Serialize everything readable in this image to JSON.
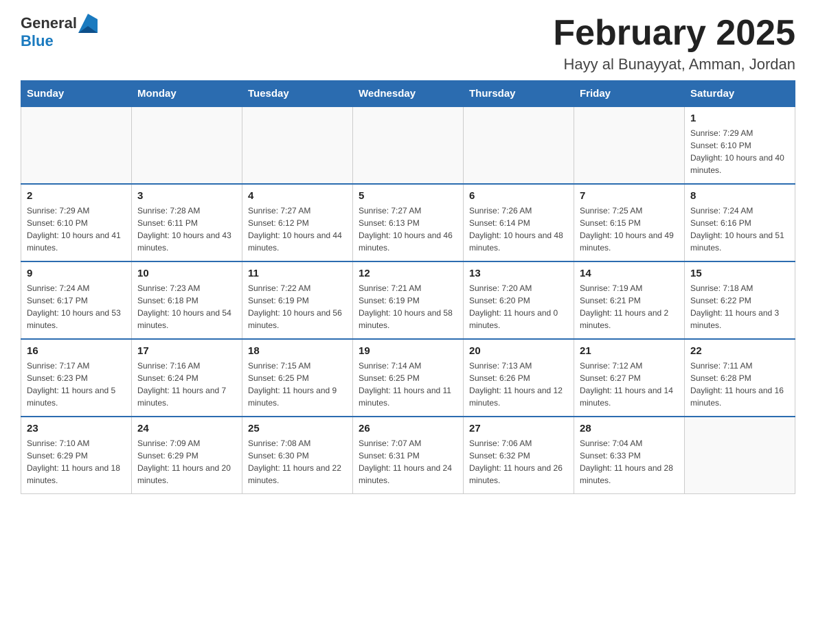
{
  "header": {
    "logo_general": "General",
    "logo_blue": "Blue",
    "month_title": "February 2025",
    "location": "Hayy al Bunayyat, Amman, Jordan"
  },
  "days_of_week": [
    "Sunday",
    "Monday",
    "Tuesday",
    "Wednesday",
    "Thursday",
    "Friday",
    "Saturday"
  ],
  "weeks": [
    [
      {
        "day": "",
        "info": ""
      },
      {
        "day": "",
        "info": ""
      },
      {
        "day": "",
        "info": ""
      },
      {
        "day": "",
        "info": ""
      },
      {
        "day": "",
        "info": ""
      },
      {
        "day": "",
        "info": ""
      },
      {
        "day": "1",
        "info": "Sunrise: 7:29 AM\nSunset: 6:10 PM\nDaylight: 10 hours and 40 minutes."
      }
    ],
    [
      {
        "day": "2",
        "info": "Sunrise: 7:29 AM\nSunset: 6:10 PM\nDaylight: 10 hours and 41 minutes."
      },
      {
        "day": "3",
        "info": "Sunrise: 7:28 AM\nSunset: 6:11 PM\nDaylight: 10 hours and 43 minutes."
      },
      {
        "day": "4",
        "info": "Sunrise: 7:27 AM\nSunset: 6:12 PM\nDaylight: 10 hours and 44 minutes."
      },
      {
        "day": "5",
        "info": "Sunrise: 7:27 AM\nSunset: 6:13 PM\nDaylight: 10 hours and 46 minutes."
      },
      {
        "day": "6",
        "info": "Sunrise: 7:26 AM\nSunset: 6:14 PM\nDaylight: 10 hours and 48 minutes."
      },
      {
        "day": "7",
        "info": "Sunrise: 7:25 AM\nSunset: 6:15 PM\nDaylight: 10 hours and 49 minutes."
      },
      {
        "day": "8",
        "info": "Sunrise: 7:24 AM\nSunset: 6:16 PM\nDaylight: 10 hours and 51 minutes."
      }
    ],
    [
      {
        "day": "9",
        "info": "Sunrise: 7:24 AM\nSunset: 6:17 PM\nDaylight: 10 hours and 53 minutes."
      },
      {
        "day": "10",
        "info": "Sunrise: 7:23 AM\nSunset: 6:18 PM\nDaylight: 10 hours and 54 minutes."
      },
      {
        "day": "11",
        "info": "Sunrise: 7:22 AM\nSunset: 6:19 PM\nDaylight: 10 hours and 56 minutes."
      },
      {
        "day": "12",
        "info": "Sunrise: 7:21 AM\nSunset: 6:19 PM\nDaylight: 10 hours and 58 minutes."
      },
      {
        "day": "13",
        "info": "Sunrise: 7:20 AM\nSunset: 6:20 PM\nDaylight: 11 hours and 0 minutes."
      },
      {
        "day": "14",
        "info": "Sunrise: 7:19 AM\nSunset: 6:21 PM\nDaylight: 11 hours and 2 minutes."
      },
      {
        "day": "15",
        "info": "Sunrise: 7:18 AM\nSunset: 6:22 PM\nDaylight: 11 hours and 3 minutes."
      }
    ],
    [
      {
        "day": "16",
        "info": "Sunrise: 7:17 AM\nSunset: 6:23 PM\nDaylight: 11 hours and 5 minutes."
      },
      {
        "day": "17",
        "info": "Sunrise: 7:16 AM\nSunset: 6:24 PM\nDaylight: 11 hours and 7 minutes."
      },
      {
        "day": "18",
        "info": "Sunrise: 7:15 AM\nSunset: 6:25 PM\nDaylight: 11 hours and 9 minutes."
      },
      {
        "day": "19",
        "info": "Sunrise: 7:14 AM\nSunset: 6:25 PM\nDaylight: 11 hours and 11 minutes."
      },
      {
        "day": "20",
        "info": "Sunrise: 7:13 AM\nSunset: 6:26 PM\nDaylight: 11 hours and 12 minutes."
      },
      {
        "day": "21",
        "info": "Sunrise: 7:12 AM\nSunset: 6:27 PM\nDaylight: 11 hours and 14 minutes."
      },
      {
        "day": "22",
        "info": "Sunrise: 7:11 AM\nSunset: 6:28 PM\nDaylight: 11 hours and 16 minutes."
      }
    ],
    [
      {
        "day": "23",
        "info": "Sunrise: 7:10 AM\nSunset: 6:29 PM\nDaylight: 11 hours and 18 minutes."
      },
      {
        "day": "24",
        "info": "Sunrise: 7:09 AM\nSunset: 6:29 PM\nDaylight: 11 hours and 20 minutes."
      },
      {
        "day": "25",
        "info": "Sunrise: 7:08 AM\nSunset: 6:30 PM\nDaylight: 11 hours and 22 minutes."
      },
      {
        "day": "26",
        "info": "Sunrise: 7:07 AM\nSunset: 6:31 PM\nDaylight: 11 hours and 24 minutes."
      },
      {
        "day": "27",
        "info": "Sunrise: 7:06 AM\nSunset: 6:32 PM\nDaylight: 11 hours and 26 minutes."
      },
      {
        "day": "28",
        "info": "Sunrise: 7:04 AM\nSunset: 6:33 PM\nDaylight: 11 hours and 28 minutes."
      },
      {
        "day": "",
        "info": ""
      }
    ]
  ]
}
